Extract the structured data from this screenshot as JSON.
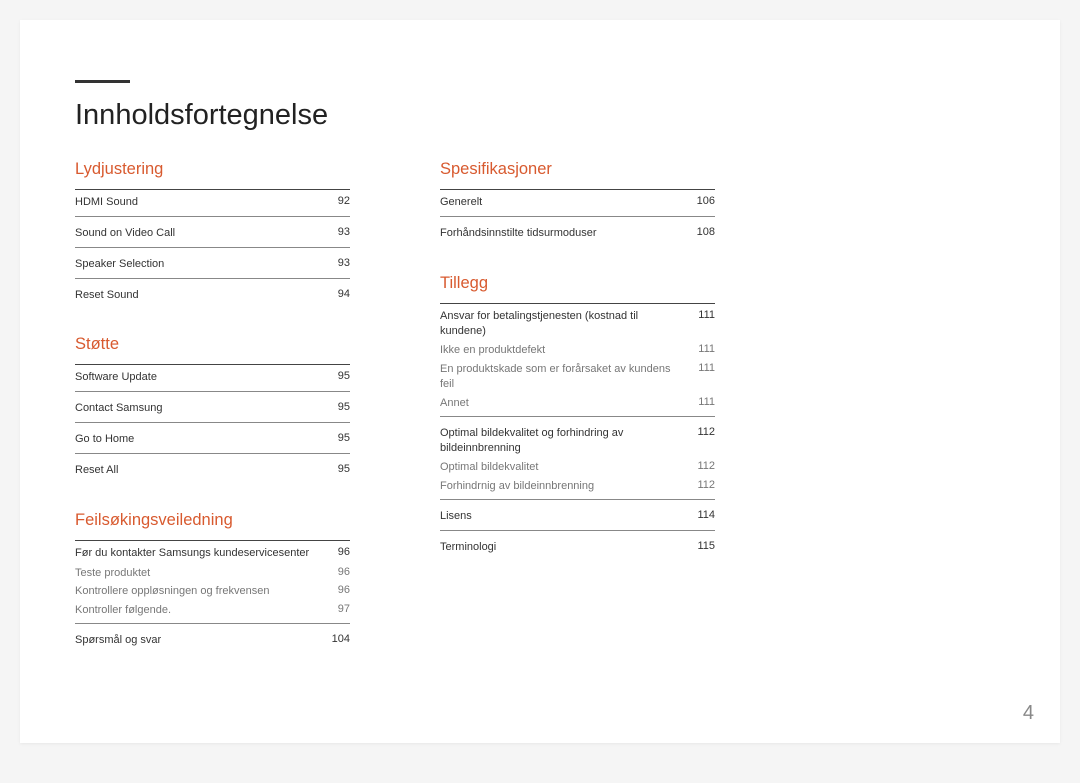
{
  "pageTitle": "Innholdsfortegnelse",
  "pageNumber": "4",
  "col1": {
    "sec1": {
      "title": "Lydjustering",
      "items": [
        {
          "label": "HDMI Sound",
          "p": "92"
        },
        {
          "label": "Sound on Video Call",
          "p": "93"
        },
        {
          "label": "Speaker Selection",
          "p": "93"
        },
        {
          "label": "Reset Sound",
          "p": "94"
        }
      ]
    },
    "sec2": {
      "title": "Støtte",
      "items": [
        {
          "label": "Software Update",
          "p": "95"
        },
        {
          "label": "Contact Samsung",
          "p": "95"
        },
        {
          "label": "Go to Home",
          "p": "95"
        },
        {
          "label": "Reset All",
          "p": "95"
        }
      ]
    },
    "sec3": {
      "title": "Feilsøkingsveiledning",
      "g1": {
        "h": {
          "label": "Før du kontakter Samsungs kundeservicesenter",
          "p": "96"
        },
        "subs": [
          {
            "label": "Teste produktet",
            "p": "96"
          },
          {
            "label": "Kontrollere oppløsningen og frekvensen",
            "p": "96"
          },
          {
            "label": "Kontroller følgende.",
            "p": "97"
          }
        ]
      },
      "g2": {
        "label": "Spørsmål og svar",
        "p": "104"
      }
    }
  },
  "col2": {
    "sec1": {
      "title": "Spesifikasjoner",
      "items": [
        {
          "label": "Generelt",
          "p": "106"
        },
        {
          "label": "Forhåndsinnstilte tidsurmoduser",
          "p": "108"
        }
      ]
    },
    "sec2": {
      "title": "Tillegg",
      "g1": {
        "h": {
          "label": "Ansvar for betalingstjenesten (kostnad til kundene)",
          "p": "111"
        },
        "subs": [
          {
            "label": "Ikke en produktdefekt",
            "p": "111"
          },
          {
            "label": "En produktskade som er forårsaket av kundens feil",
            "p": "111"
          },
          {
            "label": "Annet",
            "p": "111"
          }
        ]
      },
      "g2": {
        "h": {
          "label": "Optimal bildekvalitet og forhindring av bildeinnbrenning",
          "p": "112"
        },
        "subs": [
          {
            "label": "Optimal bildekvalitet",
            "p": "112"
          },
          {
            "label": "Forhindrnig av bildeinnbrenning",
            "p": "112"
          }
        ]
      },
      "g3": {
        "label": "Lisens",
        "p": "114"
      },
      "g4": {
        "label": "Terminologi",
        "p": "115"
      }
    }
  }
}
